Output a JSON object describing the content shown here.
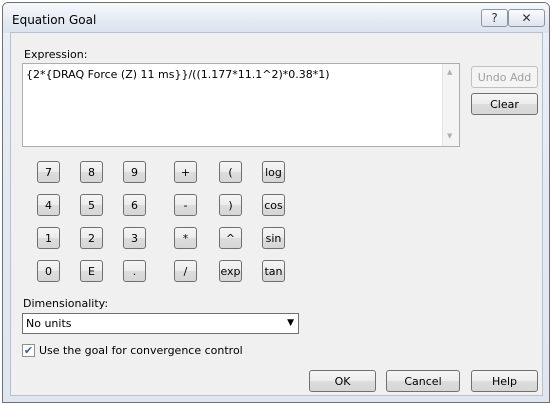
{
  "window": {
    "title": "Equation Goal",
    "help_glyph": "?",
    "close_glyph": "✕"
  },
  "expression": {
    "label": "Expression:",
    "value": "{2*{DRAQ  Force (Z) 11 ms}}/((1.177*11.1^2)*0.38*1)",
    "scroll_up": "▲",
    "scroll_down": "▼"
  },
  "side_buttons": {
    "undo_add": "Undo Add",
    "clear": "Clear"
  },
  "keypad": {
    "digits": [
      "7",
      "8",
      "9",
      "4",
      "5",
      "6",
      "1",
      "2",
      "3",
      "0",
      "E",
      "."
    ],
    "operators": [
      "+",
      "-",
      "*",
      "/"
    ],
    "specials": [
      "(",
      ")",
      "^",
      "exp"
    ],
    "functions": [
      "log",
      "cos",
      "sin",
      "tan"
    ]
  },
  "dimensionality": {
    "label": "Dimensionality:",
    "value": "No units",
    "arrow": "▼"
  },
  "convergence": {
    "label": "Use the goal for convergence control",
    "checked": true,
    "check_glyph": "✔"
  },
  "footer": {
    "ok": "OK",
    "cancel": "Cancel",
    "help": "Help"
  }
}
